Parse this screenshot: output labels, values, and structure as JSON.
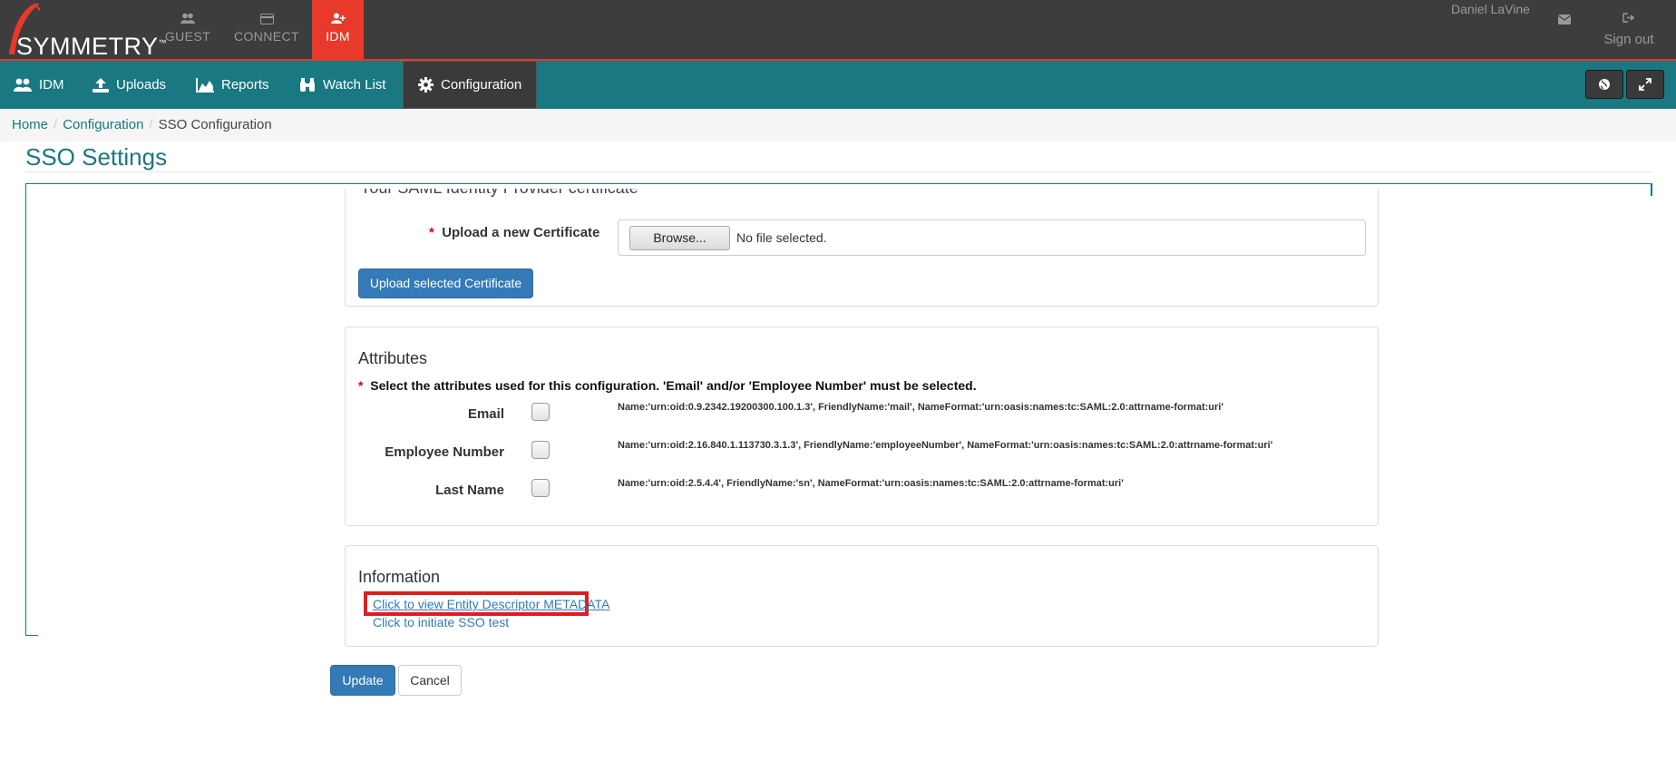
{
  "topbar": {
    "logo_text": "SYMMETRY",
    "logo_tm": "™",
    "nav": [
      {
        "label": "GUEST",
        "icon": "users-icon"
      },
      {
        "label": "CONNECT",
        "icon": "card-icon"
      },
      {
        "label": "IDM",
        "icon": "user-plus-icon",
        "active": true
      }
    ],
    "user_name": "Daniel LaVine",
    "signout_label": "Sign out",
    "accent_color": "#e8392a"
  },
  "subnav": {
    "items": [
      {
        "label": "IDM",
        "icon": "users-icon"
      },
      {
        "label": "Uploads",
        "icon": "upload-icon"
      },
      {
        "label": "Reports",
        "icon": "area-chart-icon"
      },
      {
        "label": "Watch List",
        "icon": "binoculars-icon"
      },
      {
        "label": "Configuration",
        "icon": "gear-icon",
        "active": true
      }
    ],
    "bar_color": "#197882",
    "right_buttons": [
      "globe-icon",
      "expand-icon"
    ]
  },
  "breadcrumb": {
    "home": "Home",
    "configuration": "Configuration",
    "current": "SSO Configuration",
    "separator": "/"
  },
  "page_title": "SSO Settings",
  "certificate": {
    "legend": "Your SAML Identity Provider certificate",
    "required_marker": "*",
    "upload_label": "Upload a new Certificate",
    "browse_label": "Browse...",
    "file_status": "No file selected.",
    "upload_button": "Upload selected Certificate"
  },
  "attributes": {
    "heading": "Attributes",
    "required_marker": "*",
    "instruction": "Select the attributes used for this configuration. 'Email' and/or 'Employee Number' must be selected.",
    "rows": [
      {
        "label": "Email",
        "checked": false,
        "description": "Name:'urn:oid:0.9.2342.19200300.100.1.3', FriendlyName:'mail', NameFormat:'urn:oasis:names:tc:SAML:2.0:attrname-format:uri'"
      },
      {
        "label": "Employee Number",
        "checked": false,
        "description": "Name:'urn:oid:2.16.840.1.113730.3.1.3', FriendlyName:'employeeNumber', NameFormat:'urn:oasis:names:tc:SAML:2.0:attrname-format:uri'"
      },
      {
        "label": "Last Name",
        "checked": false,
        "description": "Name:'urn:oid:2.5.4.4', FriendlyName:'sn', NameFormat:'urn:oasis:names:tc:SAML:2.0:attrname-format:uri'"
      }
    ]
  },
  "information": {
    "heading": "Information",
    "metadata_link": "Click to view Entity Descriptor METADATA",
    "sso_test_link": "Click to initiate SSO test"
  },
  "actions": {
    "update": "Update",
    "cancel": "Cancel"
  }
}
